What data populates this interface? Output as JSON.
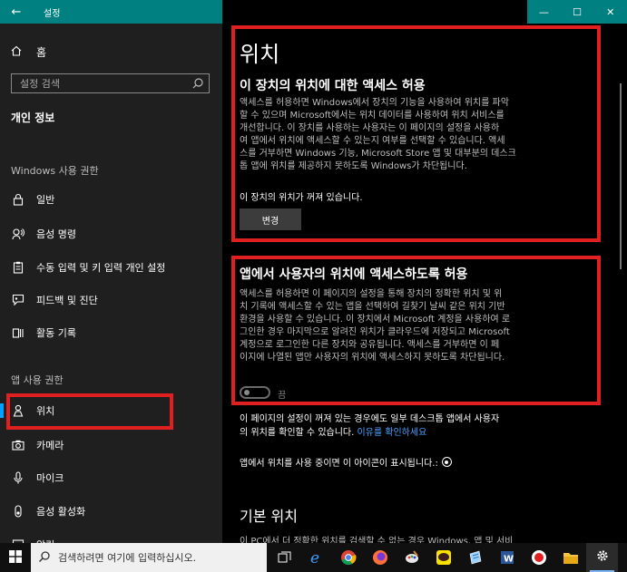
{
  "window": {
    "title": "설정",
    "back_glyph": "←",
    "controls": {
      "minimize": "—",
      "maximize": "☐",
      "close": "✕"
    }
  },
  "sidebar": {
    "home_label": "홈",
    "search_placeholder": "설정 검색",
    "section_title": "개인 정보",
    "windows_group_label": "Windows 사용 권한",
    "windows_items": [
      {
        "label": "일반",
        "icon": "lock-icon"
      },
      {
        "label": "음성 명령",
        "icon": "speech-icon"
      },
      {
        "label": "수동 입력 및 키 입력 개인 설정",
        "icon": "clipboard-icon"
      },
      {
        "label": "피드백 및 진단",
        "icon": "feedback-icon"
      },
      {
        "label": "활동 기록",
        "icon": "activity-icon"
      }
    ],
    "app_group_label": "앱 사용 권한",
    "app_items": [
      {
        "label": "위치",
        "icon": "location-icon",
        "active": true
      },
      {
        "label": "카메라",
        "icon": "camera-icon"
      },
      {
        "label": "마이크",
        "icon": "microphone-icon"
      },
      {
        "label": "음성 활성화",
        "icon": "voice-activation-icon"
      },
      {
        "label": "알림",
        "icon": "notification-icon"
      }
    ]
  },
  "main": {
    "page_title": "위치",
    "device_access": {
      "heading": "이 장치의 위치에 대한 액세스 허용",
      "lines": [
        "액세스를 허용하면 Windows에서 장치의 기능을 사용하여 위치를 파악",
        "할 수 있으며 Microsoft에서는 위치 데이터를 사용하여 위치 서비스를",
        "개선합니다. 이 장치를 사용하는 사용자는 이 페이지의 설정을 사용하",
        "여 앱에서 위치에 액세스할 수 있는지 여부를 선택할 수 있습니다. 액세",
        "스를 거부하면 Windows 기능, Microsoft Store 앱 및 대부분의 데스크",
        "톱 앱에 위치를 제공하지 못하도록 Windows가 차단됩니다."
      ],
      "status": "이 장치의 위치가 꺼져 있습니다.",
      "change_button": "변경"
    },
    "app_access": {
      "heading": "앱에서 사용자의 위치에 액세스하도록 허용",
      "lines": [
        "액세스를 허용하면 이 페이지의 설정을 통해 장치의 정확한 위치 및 위",
        "치 기록에 액세스할 수 있는 앱을 선택하여 길찾기 날씨 같은 위치 기반",
        "환경을 사용할 수 있습니다. 이 장치에서 Microsoft 계정을 사용하여 로",
        "그인한 경우 마지막으로 알려진 위치가 클라우드에 저장되고 Microsoft",
        "계정으로 로그인한 다른 장치와 공유됩니다. 액세스를 거부하면 이 페",
        "이지에 나열된 앱만 사용자의 위치에 액세스하지 못하도록 차단됩니다."
      ],
      "toggle_label": "끔",
      "toggle_on": false
    },
    "note_line1": "이 페이지의 설정이 꺼져 있는 경우에도 일부 데스크톱 앱에서 사용자",
    "note_line2": "의 위치를 확인할 수 있습니다.",
    "note_link": "이유를 확인하세요",
    "icon_notice": "앱에서 위치를 사용 중이면 이 아이콘이 표시됩니다.:",
    "default_location_heading": "기본 위치",
    "default_location_desc": "이 PC에서 더 정확한 위치를 검색할 수 없는 경우 Windows, 앱 및 서비"
  },
  "taskbar": {
    "search_placeholder": "검색하려면 여기에 입력하십시오.",
    "apps": [
      {
        "name": "task-view-icon",
        "active": false
      },
      {
        "name": "edge-icon",
        "active": false
      },
      {
        "name": "chrome-icon",
        "active": false
      },
      {
        "name": "firefox-icon",
        "active": false
      },
      {
        "name": "paint-icon",
        "active": false
      },
      {
        "name": "kakaotalk-icon",
        "active": false
      },
      {
        "name": "notepad-icon",
        "active": false
      },
      {
        "name": "word-icon",
        "active": false
      },
      {
        "name": "record-icon",
        "active": false
      },
      {
        "name": "file-explorer-icon",
        "active": false
      },
      {
        "name": "settings-icon",
        "active": true
      }
    ]
  },
  "colors": {
    "accent": "#008080",
    "highlight_box": "#e02020",
    "link": "#4aa3ff",
    "active_bar": "#00a0ff"
  }
}
